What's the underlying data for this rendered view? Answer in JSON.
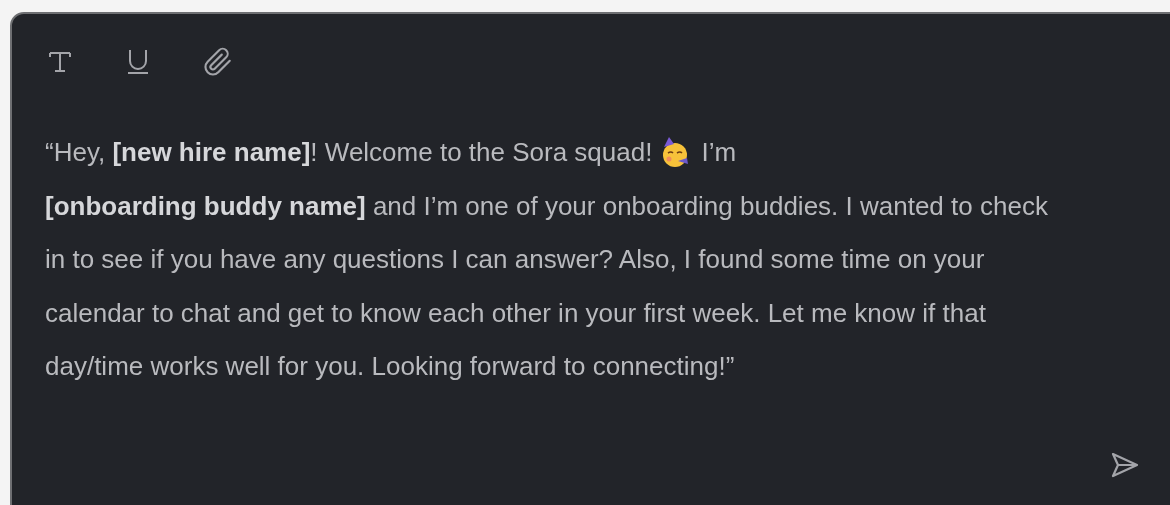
{
  "message": {
    "line_1_before_emoji": "“Hey, **[new hire name]**! Welcome to the Sora squad!",
    "line_1_after_emoji": "I’m",
    "body": "**[onboarding buddy name]** and I’m one of your onboarding buddies. I wanted to check in to see if you have any questions I can answer? Also, I found some time on your calendar to chat and get to know each other in your first week. Let me know if that day/time works well for you. Looking forward to connecting!”"
  }
}
